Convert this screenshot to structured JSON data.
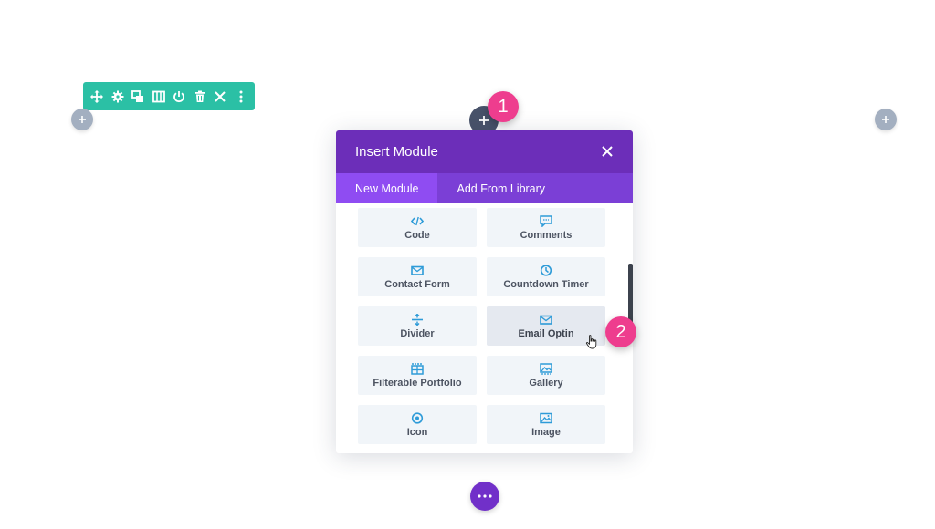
{
  "colors": {
    "toolbar_bg": "#2bc0a5",
    "modal_header": "#6c2eb9",
    "tabs_bg": "#7b3fd6",
    "tab_active": "#8f4cf2",
    "badge": "#ee3d8e",
    "module_icon": "#2e9bd8",
    "add_circle": "#a3afc0",
    "more_button": "#7130c9"
  },
  "row_toolbar": {
    "icons": [
      "move-icon",
      "settings-icon",
      "duplicate-icon",
      "columns-icon",
      "save-icon",
      "delete-icon",
      "close-icon",
      "more-vertical-icon"
    ]
  },
  "callouts": {
    "first": "1",
    "second": "2"
  },
  "modal": {
    "title": "Insert Module",
    "tabs": [
      {
        "label": "New Module",
        "active": true
      },
      {
        "label": "Add From Library",
        "active": false
      }
    ],
    "modules": [
      {
        "label": "Code",
        "icon": "code-icon"
      },
      {
        "label": "Comments",
        "icon": "comments-icon"
      },
      {
        "label": "Contact Form",
        "icon": "envelope-icon"
      },
      {
        "label": "Countdown Timer",
        "icon": "timer-icon"
      },
      {
        "label": "Divider",
        "icon": "divider-icon"
      },
      {
        "label": "Email Optin",
        "icon": "envelope-icon",
        "hovered": true
      },
      {
        "label": "Filterable Portfolio",
        "icon": "portfolio-icon"
      },
      {
        "label": "Gallery",
        "icon": "gallery-icon"
      },
      {
        "label": "Icon",
        "icon": "circle-icon"
      },
      {
        "label": "Image",
        "icon": "image-icon"
      }
    ]
  }
}
